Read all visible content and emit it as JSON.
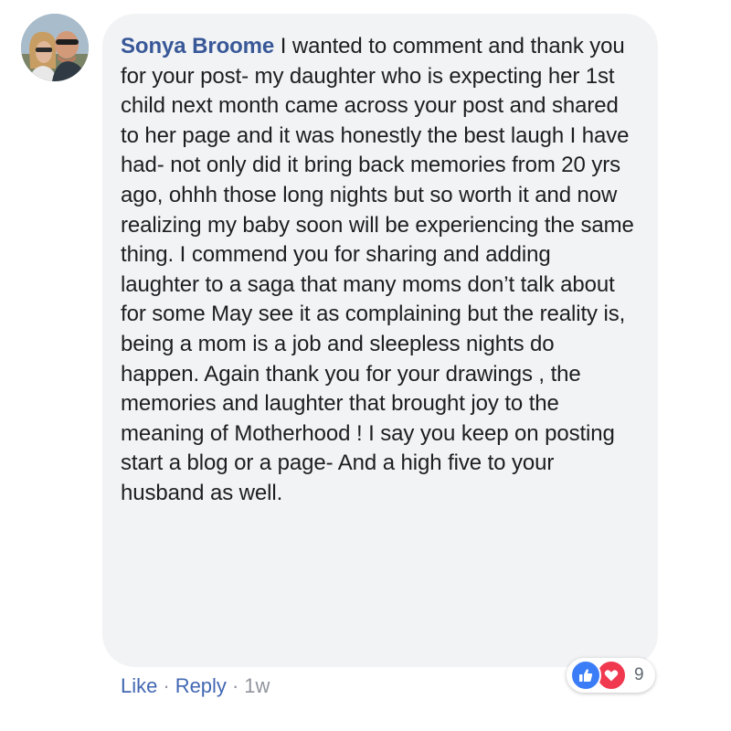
{
  "comment": {
    "author": "Sonya Broome",
    "text": "I wanted to comment and thank you for your post- my daughter who is expecting her 1st child next month came across your post and shared to her page and it was honestly the best laugh I have had- not only did it bring back memories from 20 yrs ago, ohhh those long nights but so worth it and now realizing my baby soon will be experiencing the same thing. I commend you for sharing and adding laughter to a saga that many moms don’t talk about for some May see it as complaining but the reality is, being a mom is a job and sleepless nights do happen. Again thank you for your drawings , the memories and laughter that brought joy to the meaning of Motherhood ! I say you keep on posting start a blog or a page- And a high five to your husband as well."
  },
  "reactions": {
    "icons": [
      "like-icon",
      "love-icon"
    ],
    "count": "9",
    "like_color": "#3b7df6",
    "love_color": "#f0384f"
  },
  "actions": {
    "like_label": "Like",
    "separator": "·",
    "reply_label": "Reply",
    "timestamp": "1w"
  },
  "colors": {
    "author": "#385898",
    "bubble": "#f2f3f5",
    "link": "#4267b2"
  }
}
